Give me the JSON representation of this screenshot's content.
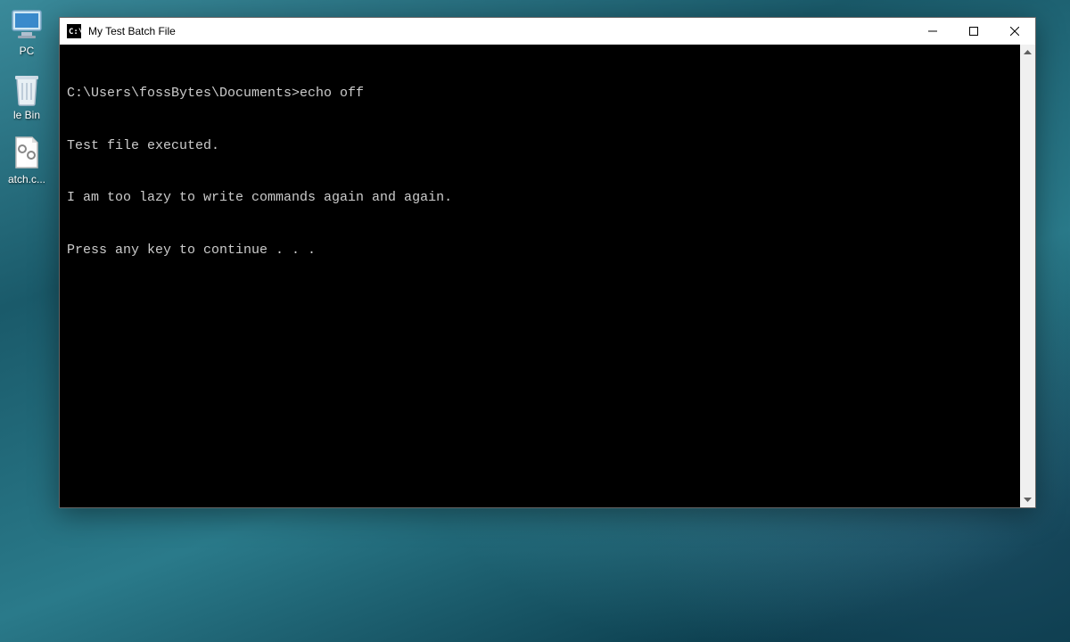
{
  "desktop": {
    "icons": [
      {
        "name": "pc",
        "label": "PC"
      },
      {
        "name": "recycle-bin",
        "label": "le Bin"
      },
      {
        "name": "batch-file",
        "label": "atch.c..."
      }
    ]
  },
  "window": {
    "title": "My Test Batch File",
    "terminal": {
      "lines": [
        "C:\\Users\\fossBytes\\Documents>echo off",
        "Test file executed.",
        "I am too lazy to write commands again and again.",
        "Press any key to continue . . ."
      ]
    }
  }
}
